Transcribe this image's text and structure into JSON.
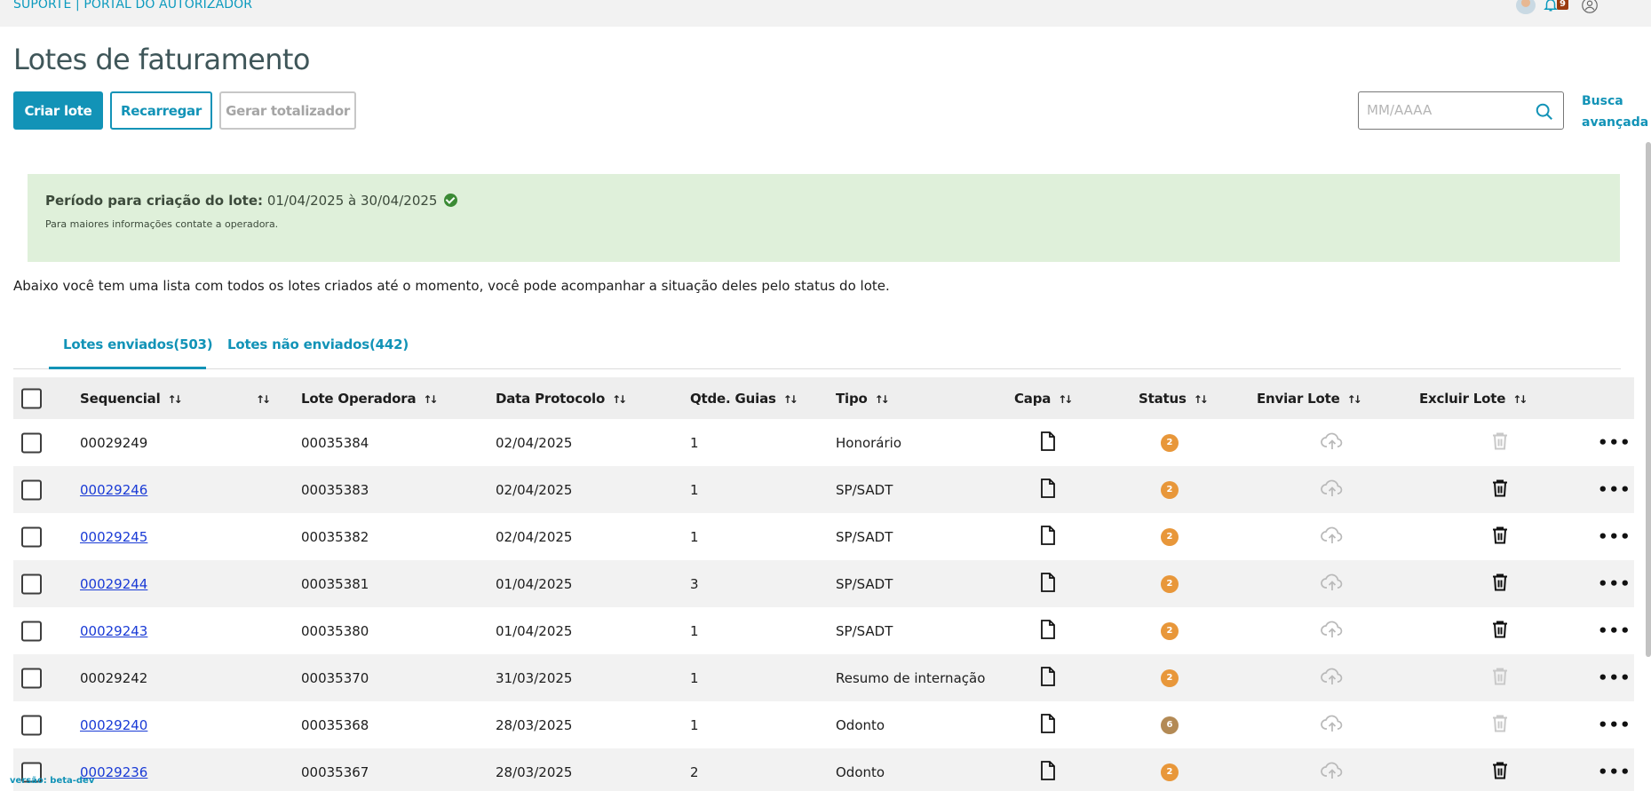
{
  "topbar": {
    "brand": "SUPORTE | PORTAL DO AUTORIZADOR",
    "notifications_count": "9"
  },
  "page": {
    "title": "Lotes de faturamento"
  },
  "toolbar": {
    "create_label": "Criar lote",
    "reload_label": "Recarregar",
    "totalizer_label": "Gerar totalizador",
    "search_placeholder": "MM/AAAA",
    "advanced_search_label": "Busca avançada"
  },
  "notice": {
    "label": "Período para criação do lote:",
    "period": "01/04/2025 à 30/04/2025",
    "info": "Para maiores informações contate a operadora."
  },
  "intro": "Abaixo você tem uma lista com todos os lotes criados até o momento, você pode acompanhar a situação deles pelo status do lote.",
  "tabs": [
    {
      "label": "Lotes enviados(503)",
      "active": true
    },
    {
      "label": "Lotes não enviados(442)",
      "active": false
    }
  ],
  "table": {
    "headers": {
      "sequencial": "Sequencial",
      "lote_operadora": "Lote Operadora",
      "data_protocolo": "Data Protocolo",
      "qtde_guias": "Qtde. Guias",
      "tipo": "Tipo",
      "capa": "Capa",
      "status": "Status",
      "enviar_lote": "Enviar Lote",
      "excluir_lote": "Excluir Lote"
    },
    "rows": [
      {
        "sequencial": "00029249",
        "linked": false,
        "lote_operadora": "00035384",
        "data_protocolo": "02/04/2025",
        "qtde_guias": "1",
        "tipo": "Honorário",
        "status": "2",
        "delete_enabled": false
      },
      {
        "sequencial": "00029246",
        "linked": true,
        "lote_operadora": "00035383",
        "data_protocolo": "02/04/2025",
        "qtde_guias": "1",
        "tipo": "SP/SADT",
        "status": "2",
        "delete_enabled": true
      },
      {
        "sequencial": "00029245",
        "linked": true,
        "lote_operadora": "00035382",
        "data_protocolo": "02/04/2025",
        "qtde_guias": "1",
        "tipo": "SP/SADT",
        "status": "2",
        "delete_enabled": true
      },
      {
        "sequencial": "00029244",
        "linked": true,
        "lote_operadora": "00035381",
        "data_protocolo": "01/04/2025",
        "qtde_guias": "3",
        "tipo": "SP/SADT",
        "status": "2",
        "delete_enabled": true
      },
      {
        "sequencial": "00029243",
        "linked": true,
        "lote_operadora": "00035380",
        "data_protocolo": "01/04/2025",
        "qtde_guias": "1",
        "tipo": "SP/SADT",
        "status": "2",
        "delete_enabled": true
      },
      {
        "sequencial": "00029242",
        "linked": false,
        "lote_operadora": "00035370",
        "data_protocolo": "31/03/2025",
        "qtde_guias": "1",
        "tipo": "Resumo de internação",
        "status": "2",
        "delete_enabled": false
      },
      {
        "sequencial": "00029240",
        "linked": true,
        "lote_operadora": "00035368",
        "data_protocolo": "28/03/2025",
        "qtde_guias": "1",
        "tipo": "Odonto",
        "status": "6",
        "delete_enabled": false
      },
      {
        "sequencial": "00029236",
        "linked": true,
        "lote_operadora": "00035367",
        "data_protocolo": "28/03/2025",
        "qtde_guias": "2",
        "tipo": "Odonto",
        "status": "2",
        "delete_enabled": true
      }
    ]
  },
  "footer": {
    "version": "versão: beta-dev"
  },
  "colors": {
    "accent": "#1293b7",
    "notice_bg": "#dff0da",
    "status_badge": "#e8973a",
    "status_badge_6": "#b38a55",
    "link": "#1a3bd6"
  }
}
